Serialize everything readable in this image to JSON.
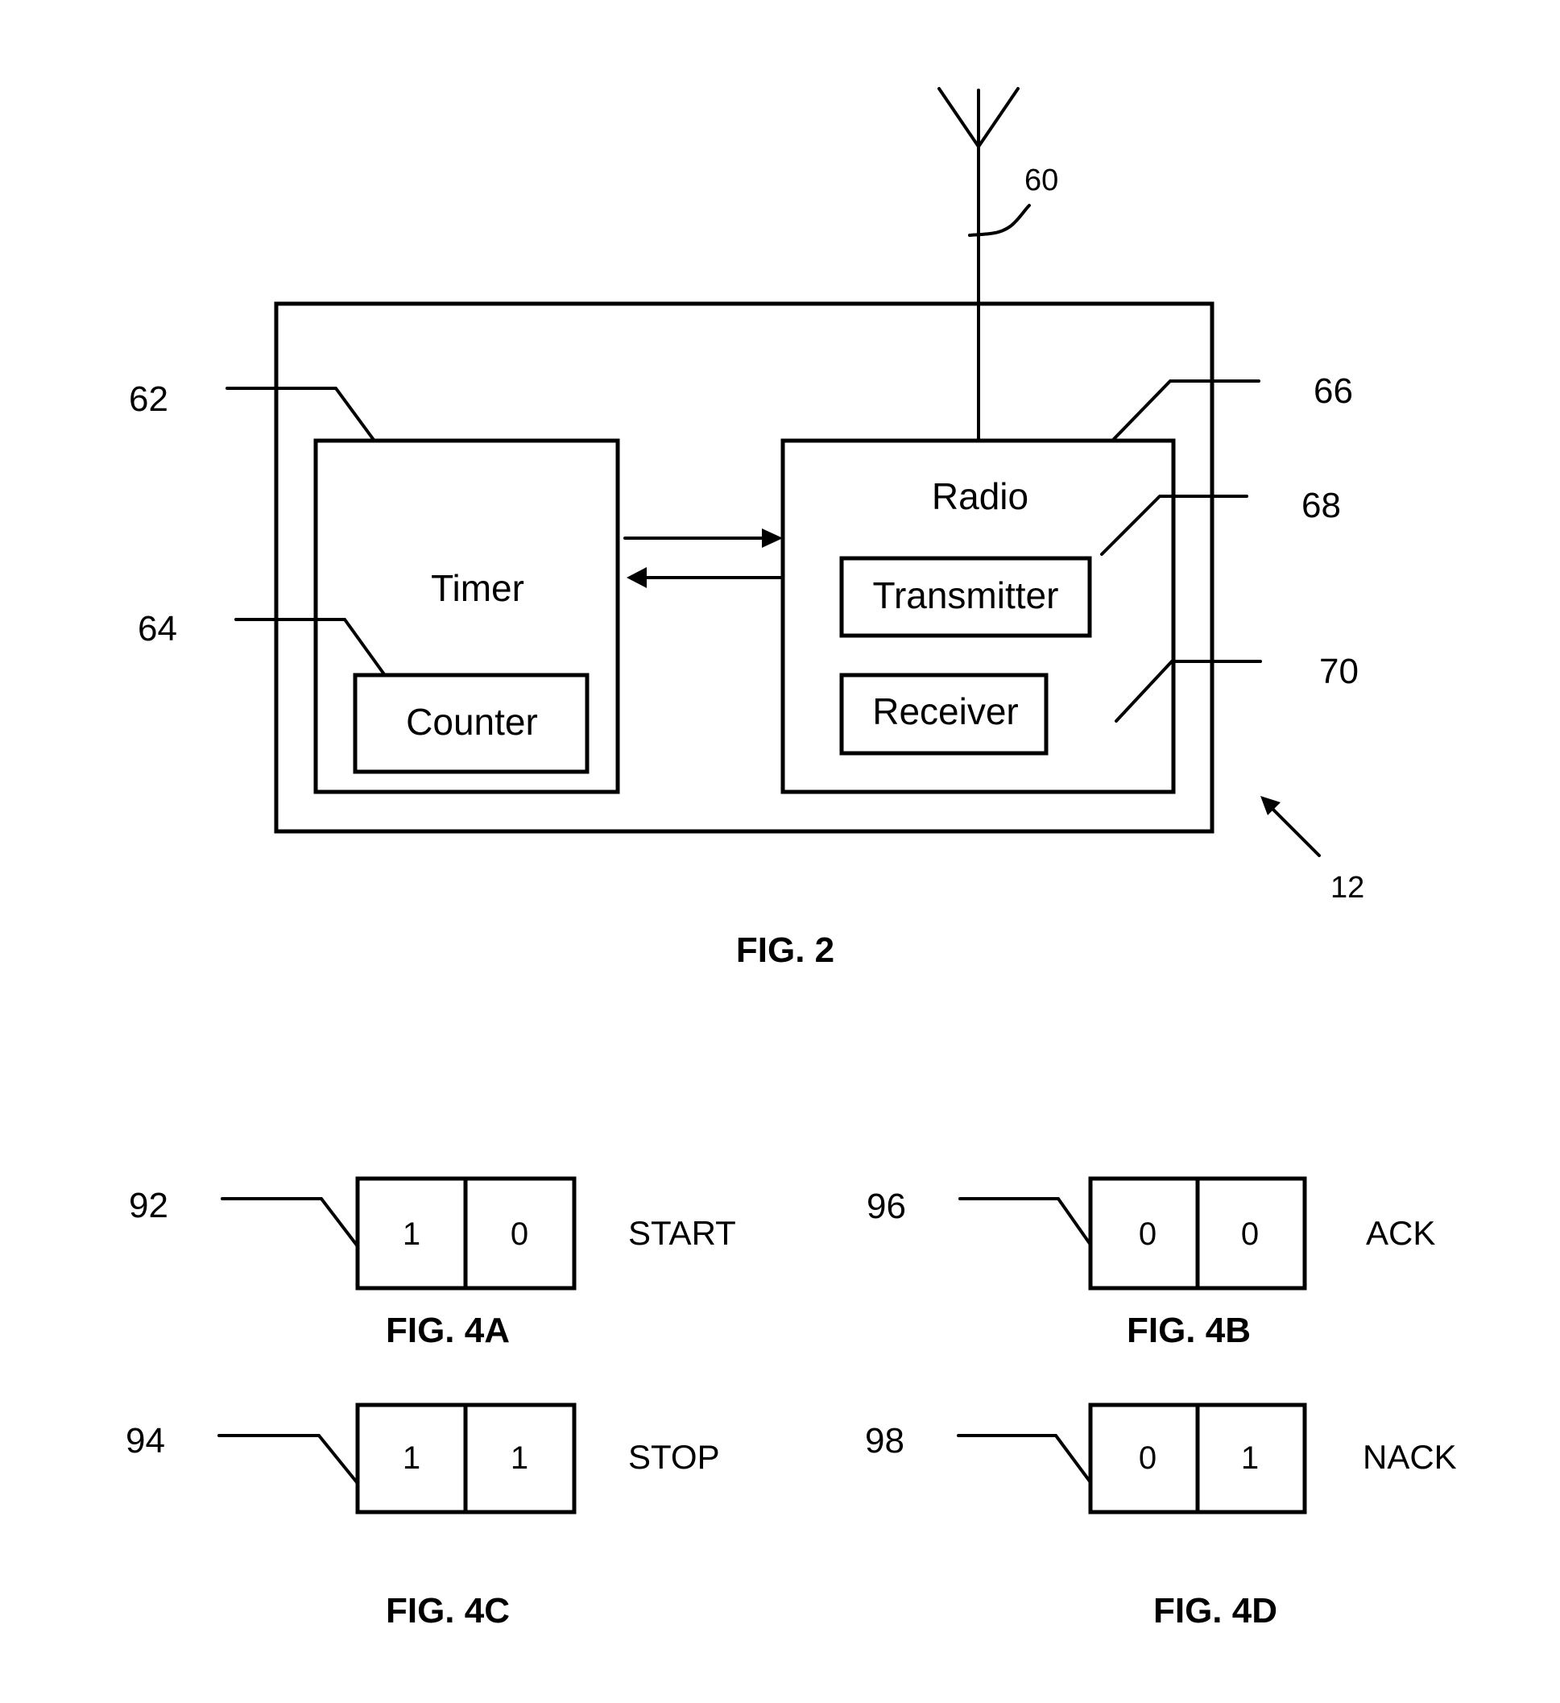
{
  "fig2": {
    "caption": "FIG. 2",
    "device_ref": "12",
    "antenna_ref": "60",
    "blocks": {
      "timer": {
        "label": "Timer",
        "ref": "62"
      },
      "counter": {
        "label": "Counter",
        "ref": "64"
      },
      "radio": {
        "label": "Radio",
        "ref": "66"
      },
      "transmitter": {
        "label": "Transmitter",
        "ref": "68"
      },
      "receiver": {
        "label": "Receiver",
        "ref": "70"
      }
    }
  },
  "fig4": {
    "panels": [
      {
        "caption": "FIG. 4A",
        "ref": "92",
        "bits": [
          "1",
          "0"
        ],
        "command": "START"
      },
      {
        "caption": "FIG. 4B",
        "ref": "96",
        "bits": [
          "0",
          "0"
        ],
        "command": "ACK"
      },
      {
        "caption": "FIG. 4C",
        "ref": "94",
        "bits": [
          "1",
          "1"
        ],
        "command": "STOP"
      },
      {
        "caption": "FIG. 4D",
        "ref": "98",
        "bits": [
          "0",
          "1"
        ],
        "command": "NACK"
      }
    ]
  }
}
